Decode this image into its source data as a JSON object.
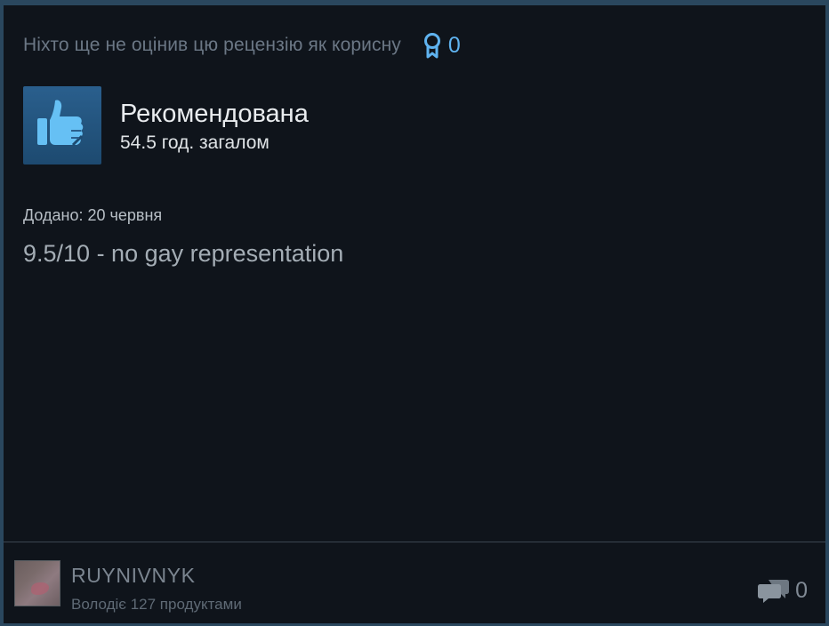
{
  "helpful": {
    "text": "Ніхто ще не оцінив цю рецензію як корисну",
    "award_icon": "award-ribbon-icon",
    "award_count": "0"
  },
  "verdict": {
    "icon": "thumbs-up-icon",
    "title": "Рекомендована",
    "hours": "54.5 год. загалом"
  },
  "review": {
    "posted": "Додано: 20 червня",
    "body": "9.5/10 - no gay representation"
  },
  "author": {
    "name": "RUYNIVNYK",
    "products": "Володіє 127 продуктами"
  },
  "comments": {
    "icon": "comments-icon",
    "count": "0"
  },
  "colors": {
    "card_background": "#0f141b",
    "accent_blue": "#5fb3f0",
    "thumb_background": "#2a5f8d",
    "thumb_icon": "#66c0f4"
  }
}
